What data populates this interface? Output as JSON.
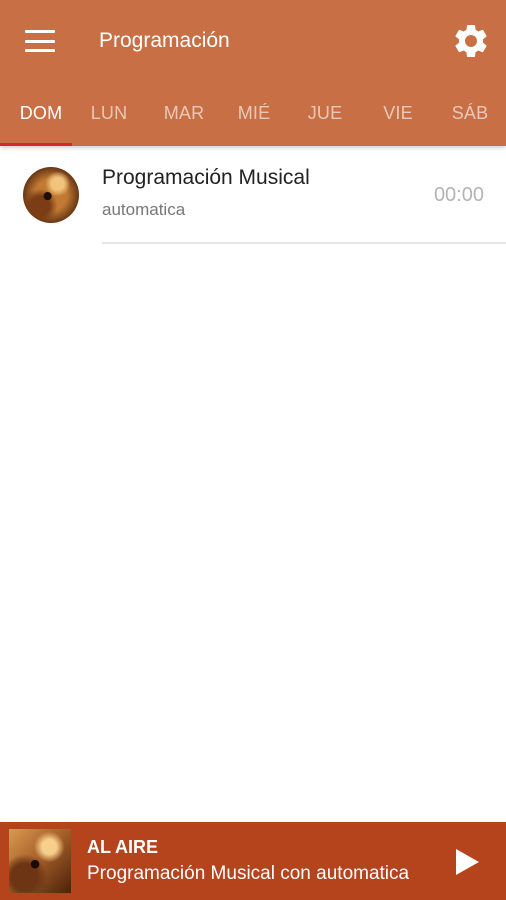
{
  "header": {
    "title": "Programación",
    "menu_icon": "hamburger-menu-icon",
    "settings_icon": "gear-icon"
  },
  "tabs": [
    {
      "label": "DOM",
      "active": true
    },
    {
      "label": "LUN",
      "active": false
    },
    {
      "label": "MAR",
      "active": false
    },
    {
      "label": "MIÉ",
      "active": false
    },
    {
      "label": "JUE",
      "active": false
    },
    {
      "label": "VIE",
      "active": false
    },
    {
      "label": "SÁB",
      "active": false
    }
  ],
  "schedule": [
    {
      "title": "Programación Musical",
      "subtitle": "automatica",
      "time": "00:00"
    }
  ],
  "player": {
    "label": "AL AIRE",
    "now_playing": "Programación Musical con automatica",
    "play_icon": "play-icon"
  },
  "colors": {
    "app_bar": "#c86f45",
    "tab_indicator": "#d6272b",
    "player_bar": "#b5431c"
  }
}
